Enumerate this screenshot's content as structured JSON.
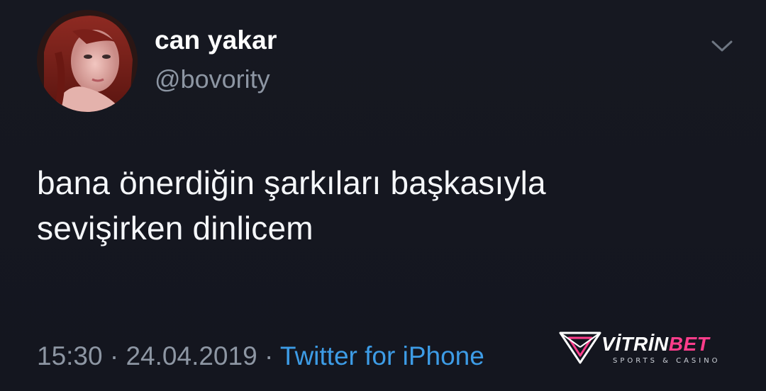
{
  "tweet": {
    "author": {
      "display_name": "can yakar",
      "handle": "@bovority"
    },
    "text_lines": [
      "bana önerdiğin şarkıları başkasıyla",
      "sevişirken dinlicem"
    ],
    "time": "15:30",
    "separator": "·",
    "date": "24.04.2019",
    "source": "Twitter for iPhone",
    "menu_icon": "chevron-down-icon"
  },
  "watermark": {
    "brand_main": "VİTRİN",
    "brand_accent": "BET",
    "tagline": "SPORTS & CASINO",
    "accent_color": "#ff3d8b"
  },
  "colors": {
    "background": "#15171f",
    "text": "#f5f7fa",
    "secondary": "#8d96a3",
    "link": "#3d9ce6"
  }
}
